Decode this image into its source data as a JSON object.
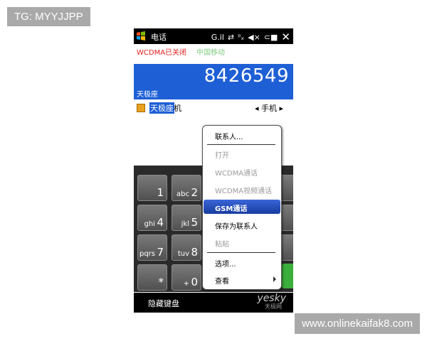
{
  "watermark_top": "TG: MYYJJPP",
  "watermark_bottom": "www.onlinekaifak8.com",
  "status": {
    "title": "电话",
    "icon_signal": "G.il",
    "icon_sync": "⇄",
    "icon_nosignal": "ᴵᴵₓ",
    "icon_volume": "◀×",
    "icon_battery": "⊂■",
    "close": "✕"
  },
  "network": {
    "wcdma": "WCDMA已关闭",
    "gsm": "中国移动"
  },
  "dialer": {
    "number": "8426549",
    "contact_label": "天极座"
  },
  "match": {
    "highlight": "天极座",
    "rest": "机",
    "type": "◂ 手机 ▸"
  },
  "keys": [
    {
      "digit": "1",
      "letters": ""
    },
    {
      "digit": "2",
      "letters": "abc"
    },
    {
      "digit": "4",
      "letters": "ghi"
    },
    {
      "digit": "5",
      "letters": "jkl"
    },
    {
      "digit": "7",
      "letters": "pqrs"
    },
    {
      "digit": "8",
      "letters": "tuv"
    },
    {
      "digit": "*",
      "letters": ""
    },
    {
      "digit": "0",
      "letters": "+"
    }
  ],
  "menu": {
    "contacts": "联系人...",
    "open": "打开",
    "wcdma_call": "WCDMA通话",
    "wcdma_video": "WCDMA视频通话",
    "gsm_call": "GSM通话",
    "save_contact": "保存为联系人",
    "paste": "粘贴",
    "options": "选项...",
    "view": "查看"
  },
  "bottom": {
    "hide_keyboard": "隐藏键盘",
    "logo": "yesky",
    "logo_sub": "天极网"
  },
  "colors": {
    "accent_blue": "#1e5fd6",
    "wcdma_red": "#e31c1c",
    "call_green": "#3cae3c"
  }
}
